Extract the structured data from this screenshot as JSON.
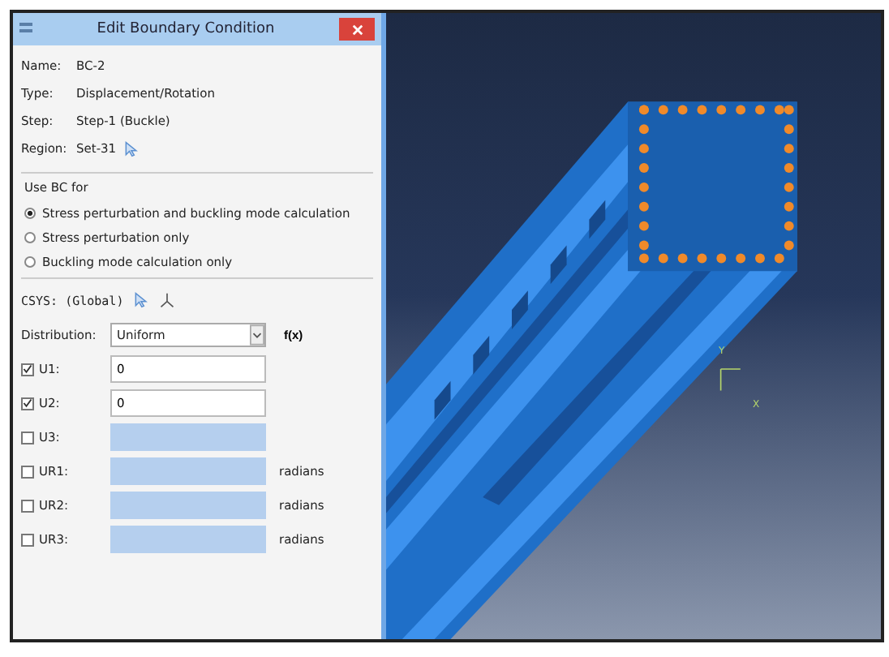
{
  "dialog": {
    "title": "Edit Boundary Condition",
    "info": [
      {
        "label": "Name:",
        "value": "BC-2"
      },
      {
        "label": "Type:",
        "value": "Displacement/Rotation"
      },
      {
        "label": "Step:",
        "value": "Step-1 (Buckle)"
      },
      {
        "label": "Region:",
        "value": "Set-31",
        "kind": "pick"
      }
    ],
    "use_bc_for": {
      "title": "Use BC for",
      "options": [
        {
          "label": "Stress perturbation and buckling mode calculation",
          "selected": true
        },
        {
          "label": "Stress perturbation only",
          "selected": false
        },
        {
          "label": "Buckling mode calculation only",
          "selected": false
        }
      ]
    },
    "csys": "CSYS: (Global)",
    "distribution": {
      "label": "Distribution:",
      "value": "Uniform",
      "fx": "f(x)"
    },
    "dofs": [
      {
        "label": "U1:",
        "checked": true,
        "value": "0"
      },
      {
        "label": "U2:",
        "checked": true,
        "value": "0"
      },
      {
        "label": "U3:",
        "checked": false
      },
      {
        "label": "UR1:",
        "checked": false,
        "unit": "radians"
      },
      {
        "label": "UR2:",
        "checked": false,
        "unit": "radians"
      },
      {
        "label": "UR3:",
        "checked": false,
        "unit": "radians"
      }
    ]
  },
  "viewport": {
    "triad": [
      "Y",
      "X"
    ]
  }
}
